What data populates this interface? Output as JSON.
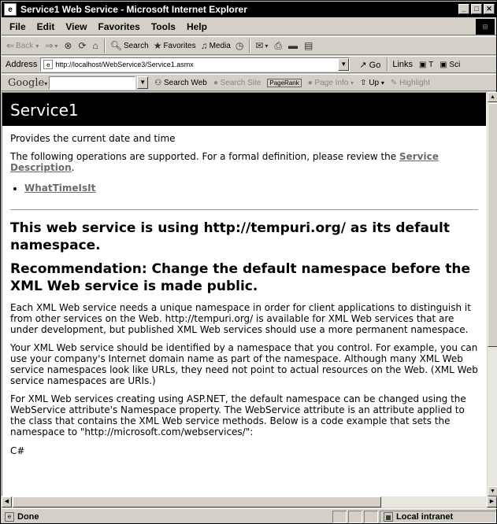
{
  "window": {
    "title": "Service1 Web Service - Microsoft Internet Explorer",
    "controls": [
      "_",
      "□",
      "✕"
    ]
  },
  "menubar": {
    "items": [
      "File",
      "Edit",
      "View",
      "Favorites",
      "Tools",
      "Help"
    ]
  },
  "toolbar": {
    "back": "Back",
    "forward": "",
    "stop": "",
    "refresh": "",
    "home": "",
    "search": "Search",
    "favorites": "Favorites",
    "media": "Media",
    "history": "",
    "mail": "",
    "print": "",
    "edit": ""
  },
  "addressbar": {
    "label": "Address",
    "url": "http://localhost/WebService3/Service1.asmx",
    "go": "Go",
    "links_label": "Links",
    "link_items": [
      "T",
      "Sci"
    ]
  },
  "googlebar": {
    "logo": "Google",
    "search_value": "",
    "search_web": "Search Web",
    "search_site": "Search Site",
    "pagerank": "PageRank",
    "page_info": "Page Info",
    "up": "Up",
    "highlight": "Highlight"
  },
  "page": {
    "heading": "Service1",
    "description": "Provides the current date and time",
    "operations_intro_before": "The following operations are supported. For a formal definition, please review the ",
    "service_description_link": "Service Description",
    "operations_intro_after": ".",
    "operations": [
      "WhatTimeIsIt"
    ],
    "namespace_warning": "This web service is using http://tempuri.org/ as its default namespace.",
    "recommendation": "Recommendation: Change the default namespace before the XML Web service is made public.",
    "paragraph1": "Each XML Web service needs a unique namespace in order for client applications to distinguish it from other services on the Web. http://tempuri.org/ is available for XML Web services that are under development, but published XML Web services should use a more permanent namespace.",
    "paragraph2": "Your XML Web service should be identified by a namespace that you control. For example, you can use your company's Internet domain name as part of the namespace. Although many XML Web service namespaces look like URLs, they need not point to actual resources on the Web. (XML Web service namespaces are URIs.)",
    "paragraph3": "For XML Web services creating using ASP.NET, the default namespace can be changed using the WebService attribute's Namespace property. The WebService attribute is an attribute applied to the class that contains the XML Web service methods. Below is a code example that sets the namespace to \"http://microsoft.com/webservices/\":",
    "code_label": "C#"
  },
  "statusbar": {
    "status": "Done",
    "zone": "Local intranet"
  }
}
